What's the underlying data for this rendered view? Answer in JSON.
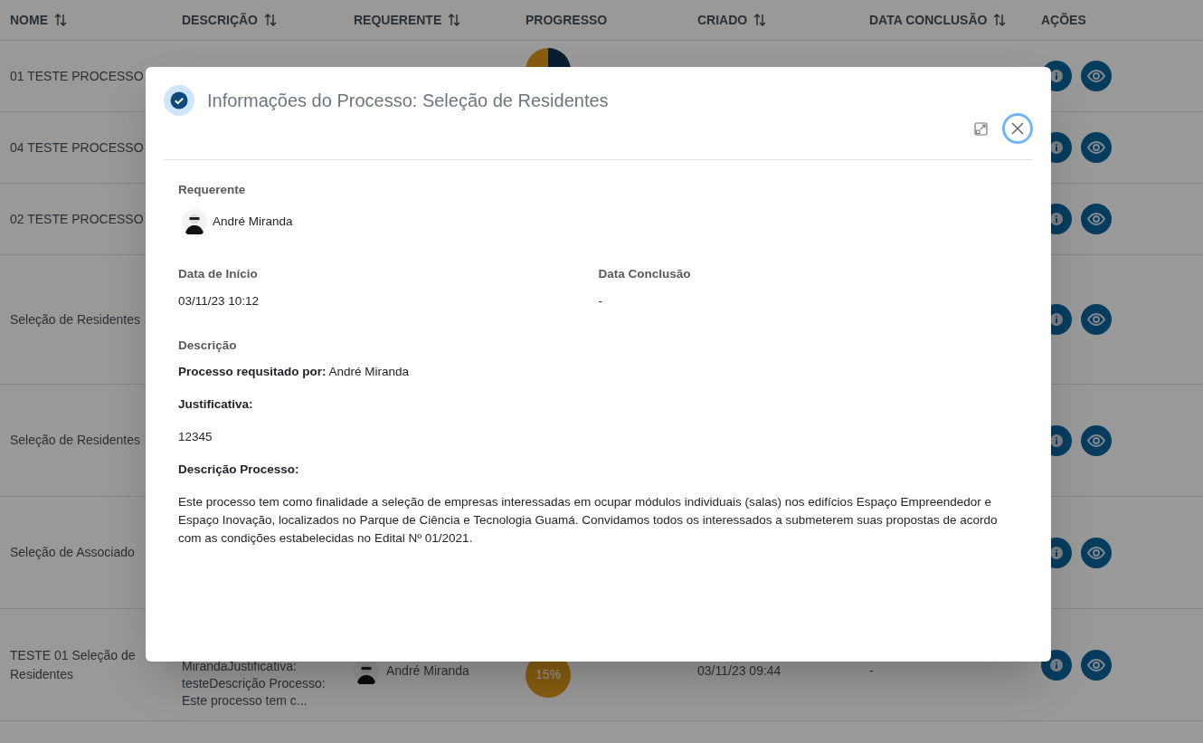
{
  "table": {
    "columns": [
      {
        "label": "NOME",
        "sortable": true
      },
      {
        "label": "DESCRIÇÃO",
        "sortable": true
      },
      {
        "label": "REQUERENTE",
        "sortable": true
      },
      {
        "label": "PROGRESSO",
        "sortable": false
      },
      {
        "label": "CRIADO",
        "sortable": true
      },
      {
        "label": "DATA CONCLUSÃO",
        "sortable": true
      },
      {
        "label": "AÇÕES",
        "sortable": false
      }
    ],
    "rows": [
      {
        "name": "01 TESTE PROCESSO"
      },
      {
        "name": "04 TESTE PROCESSO"
      },
      {
        "name": "02 TESTE PROCESSO"
      },
      {
        "name": "Seleção de Residentes"
      },
      {
        "name": "Seleção de Residentes"
      },
      {
        "name": "Seleção de Associado"
      },
      {
        "name": "TESTE 01 Seleção de Residentes",
        "description": [
          "MirandaJustificativa:",
          "testeDescrição Processo:",
          "Este processo tem c..."
        ],
        "requester": "André Miranda",
        "progress": "15%",
        "created": "03/11/23 09:44",
        "completion": "-"
      }
    ]
  },
  "modal": {
    "title": "Informações do Processo: Seleção de Residentes",
    "requester": {
      "label": "Requerente",
      "name": "André Miranda"
    },
    "start": {
      "label": "Data de Início",
      "value": "03/11/23 10:12"
    },
    "completion": {
      "label": "Data Conclusão",
      "value": "-"
    },
    "description": {
      "label": "Descrição",
      "paragraphs": [
        {
          "kind": "text",
          "text": "**Processo requsitado por:** André Miranda"
        },
        {
          "kind": "heading",
          "text": "Justificativa:"
        },
        {
          "kind": "text",
          "text": "12345"
        },
        {
          "kind": "heading",
          "text": "Descrição Processo:"
        },
        {
          "kind": "text",
          "text": "Este processo tem como finalidade a seleção de empresas interessadas em ocupar módulos individuais (salas) nos edifícios Espaço Empreendedor e Espaço Inovação, localizados no Parque de Ciência e Tecnologia Guamá. Convidamos todos os interessados a submeterem suas propostas de acordo com as condições estabelecidas no Edital Nº 01/2021."
        }
      ]
    }
  }
}
